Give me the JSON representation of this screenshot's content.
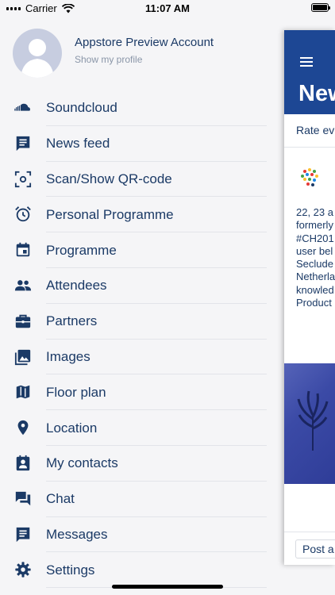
{
  "status_bar": {
    "carrier": "Carrier",
    "time": "11:07 AM"
  },
  "profile": {
    "name": "Appstore Preview Account",
    "link": "Show my profile"
  },
  "menu": [
    {
      "label": "Soundcloud",
      "icon": "soundcloud-icon"
    },
    {
      "label": "News feed",
      "icon": "news-feed-icon"
    },
    {
      "label": "Scan/Show QR-code",
      "icon": "qr-scan-icon"
    },
    {
      "label": "Personal Programme",
      "icon": "alarm-clock-icon"
    },
    {
      "label": "Programme",
      "icon": "calendar-icon"
    },
    {
      "label": "Attendees",
      "icon": "people-icon"
    },
    {
      "label": "Partners",
      "icon": "briefcase-icon"
    },
    {
      "label": "Images",
      "icon": "images-icon"
    },
    {
      "label": "Floor plan",
      "icon": "map-icon"
    },
    {
      "label": "Location",
      "icon": "location-pin-icon"
    },
    {
      "label": "My contacts",
      "icon": "contacts-icon"
    },
    {
      "label": "Chat",
      "icon": "chat-icon"
    },
    {
      "label": "Messages",
      "icon": "messages-icon"
    },
    {
      "label": "Settings",
      "icon": "gear-icon"
    }
  ],
  "underlay": {
    "title": "New",
    "tab_text": "Rate ev",
    "post_text": "22, 23 a\nformerly\n#CH201\nuser bel\nSeclude\nNetherla\nknowled\nProduct",
    "post_button": "Post a"
  },
  "colors": {
    "accent": "#1b3a66",
    "header": "#1d4794",
    "background": "#f5f5f7"
  }
}
